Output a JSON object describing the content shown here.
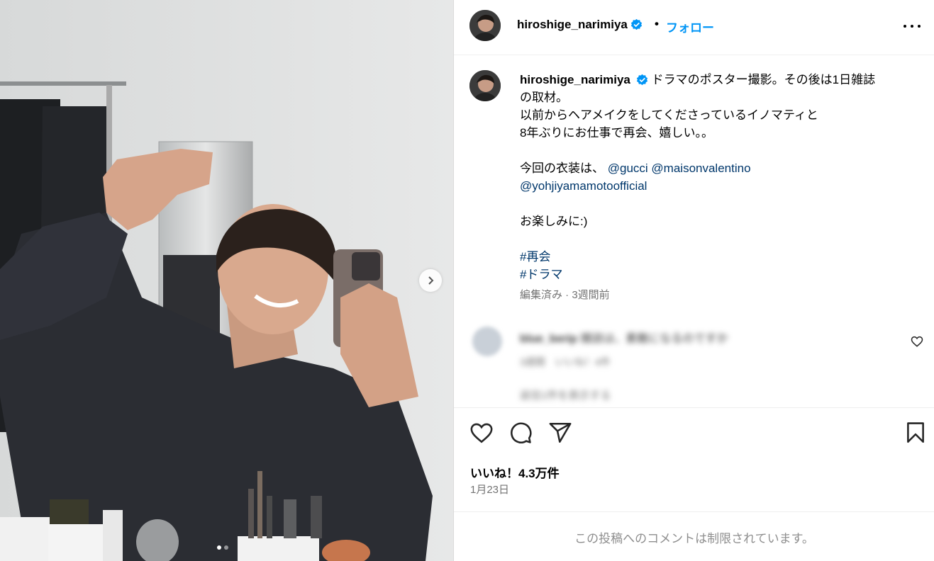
{
  "post": {
    "author": "hiroshige_narimiya",
    "follow_label": "フォロー",
    "bullet": "•",
    "caption_lines": [
      "ドラマのポスター撮影。その後は1日雑誌",
      "の取材。",
      "以前からヘアメイクをしてくださっているイノマティと",
      "8年ぶりにお仕事で再会、嬉しい。。",
      "",
      "今回の衣装は、"
    ],
    "mentions": [
      "@gucci",
      "@maisonvalentino",
      "@yohjiyamamotoofficial"
    ],
    "closing_line": "お楽しみに:)",
    "hashtags": [
      "#再会",
      "#ドラマ"
    ],
    "meta": "編集済み · 3週間前",
    "likes": "いいね！4.3万件",
    "date": "1月23日",
    "comments_limited": "この投稿へのコメントは制限されています。"
  },
  "comment": {
    "author": "blue_berip",
    "text": "雑誌は、素敵になるのですか",
    "meta": "3週間　いいね！4件",
    "replies": "返信1件を表示する"
  },
  "carousel": {
    "slide_count": 2,
    "active_index": 0
  },
  "colors": {
    "link": "#0095f6",
    "mention": "#00376b",
    "muted": "#737373",
    "verified": "#0095f6"
  },
  "icons": [
    "verified-badge-icon",
    "more-options-icon",
    "chevron-right-icon",
    "heart-icon",
    "comment-icon",
    "share-icon",
    "bookmark-icon"
  ]
}
